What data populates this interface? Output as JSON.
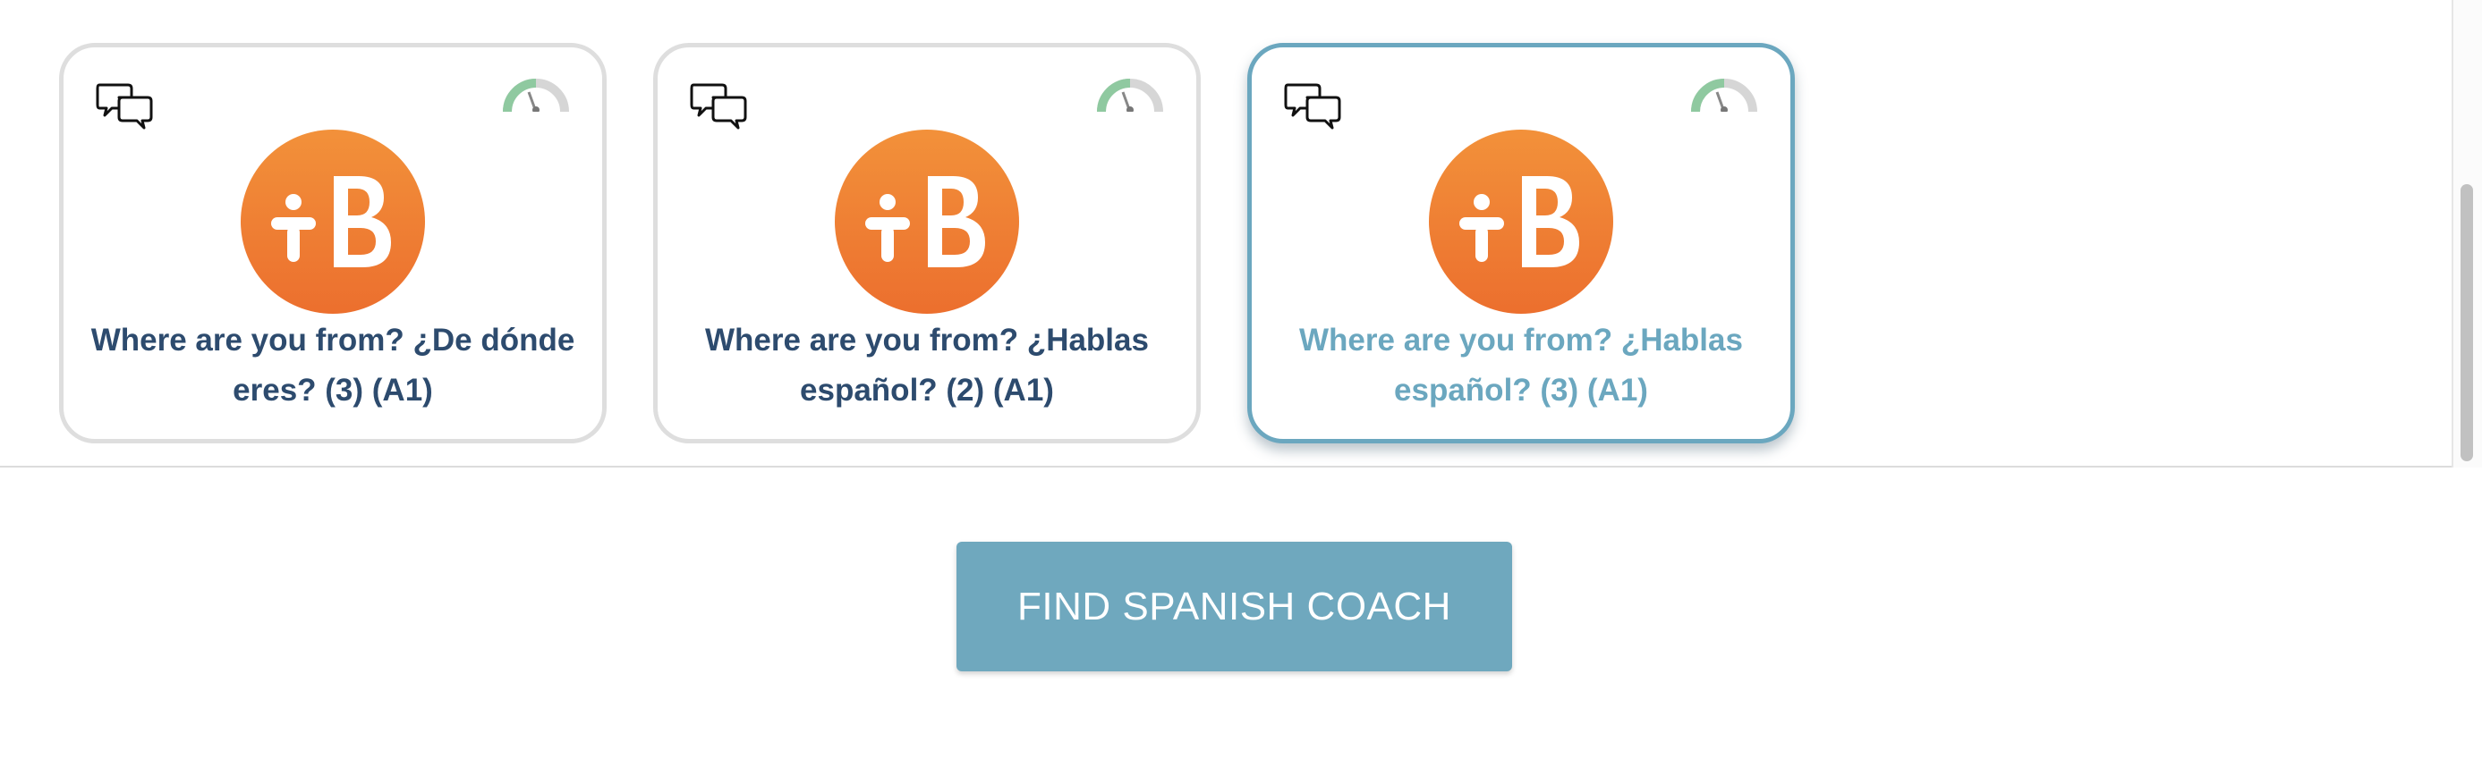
{
  "cards": [
    {
      "title": "Where are you from? ¿De dónde eres? (3) (A1)",
      "selected": false,
      "icons": [
        "chat-bubbles-icon",
        "difficulty-gauge-icon",
        "babbel-logo"
      ]
    },
    {
      "title": "Where are you from? ¿Hablas español? (2) (A1)",
      "selected": false,
      "icons": [
        "chat-bubbles-icon",
        "difficulty-gauge-icon",
        "babbel-logo"
      ]
    },
    {
      "title": "Where are you from? ¿Hablas español? (3) (A1)",
      "selected": true,
      "icons": [
        "chat-bubbles-icon",
        "difficulty-gauge-icon",
        "babbel-logo"
      ]
    }
  ],
  "action": {
    "find_coach_label": "FIND SPANISH COACH"
  },
  "colors": {
    "brand_orange": "#ef7f33",
    "title_dark": "#2d4b6e",
    "accent_teal": "#6ba7bf",
    "card_border": "#dedede",
    "button_bg": "#6fa8be",
    "gauge_green": "#8fc9a0",
    "gauge_grey": "#cfcfcf"
  }
}
